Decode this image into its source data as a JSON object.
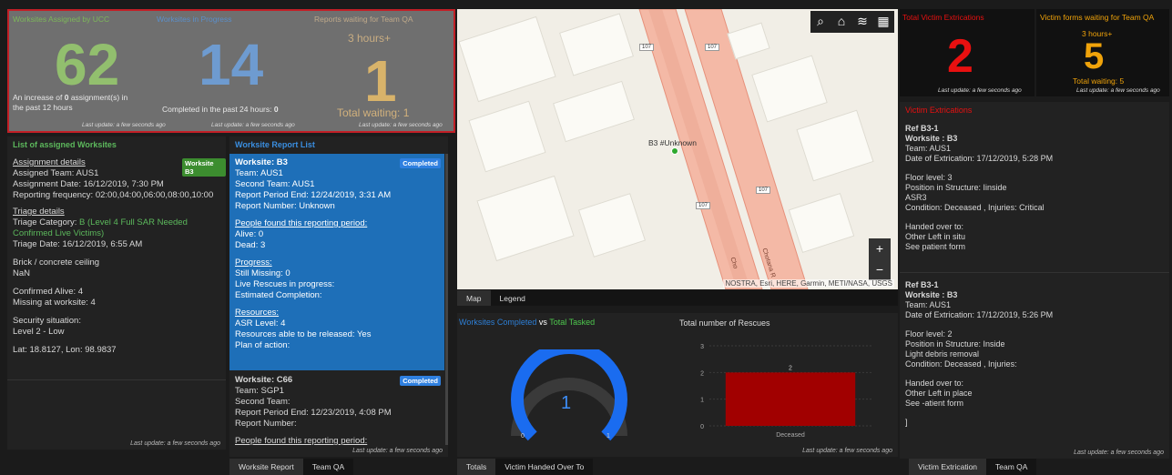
{
  "indicators": {
    "assigned": {
      "title": "Worksites Assigned by UCC",
      "value": "62",
      "line1_a": "An increase of",
      "line1_b": "0",
      "line1_c": "assignment(s) in",
      "line2": "the past 12 hours",
      "footer": "Last update: a few seconds ago"
    },
    "progress": {
      "title": "Worksites in Progress",
      "value": "14",
      "sub_a": "Completed in the past 24 hours:",
      "sub_b": "0",
      "footer": "Last update: a few seconds ago"
    },
    "qa": {
      "title": "Reports waiting for Team QA",
      "top": "3 hours+",
      "value": "1",
      "sub": "Total waiting: 1",
      "footer": "Last update: a few seconds ago"
    }
  },
  "worksites": {
    "title": "List of assigned Worksites",
    "badge": "Worksite B3",
    "assignment_heading": "Assignment details",
    "assigned_team": "Assigned Team:  AUS1",
    "assignment_date": "Assignment Date: 16/12/2019, 7:30 PM",
    "reporting_freq": "Reporting frequency: 02:00,04:00,06:00,08:00,10:00",
    "triage_heading": "Triage details",
    "triage_cat_label": "Triage Category:",
    "triage_cat_value1": "B (Level 4 Full SAR Needed",
    "triage_cat_value2": "Confirmed Live Victims)",
    "triage_date": "Triage Date:  16/12/2019, 6:55 AM",
    "structure": "Brick / concrete ceiling",
    "nan": "NaN",
    "confirmed_alive": "Confirmed Alive:  4",
    "missing": "Missing at worksite:  4",
    "security_label": "Security situation:",
    "security_value": "Level 2 - Low",
    "latlon": "Lat: 18.8127, Lon: 98.9837",
    "footer": "Last update: a few seconds ago"
  },
  "reports": {
    "title": "Worksite Report List",
    "card1": {
      "badge": "Completed",
      "worksite": "Worksite: B3",
      "team": "Team:  AUS1",
      "second_team": "Second Team:  AUS1",
      "period_end": "Report Period End:  12/24/2019, 3:31 AM",
      "report_number": "Report Number:  Unknown",
      "people_heading": "People found this reporting period:",
      "alive": "Alive:  0",
      "dead": "Dead: 3",
      "progress_heading": "Progress:",
      "still_missing": "Still Missing:  0",
      "live_rescues": "Live Rescues in progress:",
      "est_completion": "Estimated Completion:",
      "resources_heading": "Resources:",
      "asr_level": "ASR Level:  4",
      "released": "Resources able to be released:  Yes",
      "plan": "Plan of action:"
    },
    "card2": {
      "badge": "Completed",
      "worksite": "Worksite: C66",
      "team": "Team:  SGP1",
      "second_team": "Second Team:",
      "period_end": "Report Period End:  12/23/2019, 4:08 PM",
      "report_number": "Report Number:",
      "people_heading": "People found this reporting period:"
    },
    "footer": "Last update: a few seconds ago"
  },
  "bottom_tabs_left": [
    "Worksite Report",
    "Team QA"
  ],
  "map": {
    "marker_label": "B3 #Unknown",
    "road_labels": [
      "107",
      "107",
      "107",
      "107"
    ],
    "street_name_1": "Chotana R",
    "street_name_2": "Cho",
    "attribution": "NOSTRA, Esri, HERE, Garmin, METI/NASA, USGS",
    "tools": [
      "search-icon",
      "home-icon",
      "layers-icon",
      "basemap-gallery-icon"
    ],
    "zoom_in": "+",
    "zoom_out": "−",
    "tabs": [
      "Map",
      "Legend"
    ]
  },
  "gauge": {
    "title_a": "Worksites Completed",
    "title_vs": "vs",
    "title_b": "Total Tasked",
    "value": "1",
    "min": "0",
    "max": "1",
    "fraction": 1.0
  },
  "rescues_chart_title": "Total number of Rescues",
  "chart_data": {
    "type": "bar",
    "title": "Total number of Rescues",
    "categories": [
      "Deceased"
    ],
    "values": [
      2
    ],
    "ylim": [
      0,
      3
    ],
    "yticks": [
      "0",
      "1",
      "2",
      "3"
    ],
    "data_labels": [
      "2"
    ],
    "bar_color": "#a10000",
    "grid": true
  },
  "middle_footer": "Last update: a few seconds ago",
  "bottom_tabs_mid": [
    "Totals",
    "Victim Handed Over To"
  ],
  "extrications": {
    "title": "Total Victim Extrications",
    "value": "2",
    "footer": "Last update: a few seconds ago"
  },
  "victim_forms": {
    "title": "Victim forms waiting for Team QA",
    "top": "3 hours+",
    "value": "5",
    "sub": "Total waiting: 5",
    "footer": "Last update: a few seconds ago"
  },
  "victim_list": {
    "title": "Victim Extrications",
    "items": [
      {
        "ref": "Ref B3-1",
        "worksite": "Worksite : B3",
        "team": "Team: AUS1",
        "date": "Date of Extrication:  17/12/2019, 5:28 PM",
        "floor": "Floor level:  3",
        "position": "Position in Structure:  Iinside",
        "extra": "ASR3",
        "condition": "Condition: Deceased , Injuries: Critical",
        "handed": "Handed over to:",
        "other": "Other Left in situ",
        "see": "See patient form"
      },
      {
        "ref": "Ref B3-1",
        "worksite": "Worksite : B3",
        "team": "Team: AUS1",
        "date": "Date of Extrication:  17/12/2019, 5:26 PM",
        "floor": "Floor level:  2",
        "position": "Position in Structure:  Inside",
        "extra": "Light debris removal",
        "condition": "Condition: Deceased , Injuries:",
        "handed": "Handed over to:",
        "other": "Other Left in place",
        "see": "See -atient form",
        "bracket": "]"
      }
    ],
    "footer": "Last update: a few seconds ago"
  },
  "bottom_tabs_right": [
    "Victim Extrication",
    "Team QA"
  ],
  "colors": {
    "green": "#5cb85c",
    "blue": "#1e73c8",
    "orange": "#f0a30a",
    "red": "#e81010",
    "gauge_blue": "#1a6cf0"
  }
}
